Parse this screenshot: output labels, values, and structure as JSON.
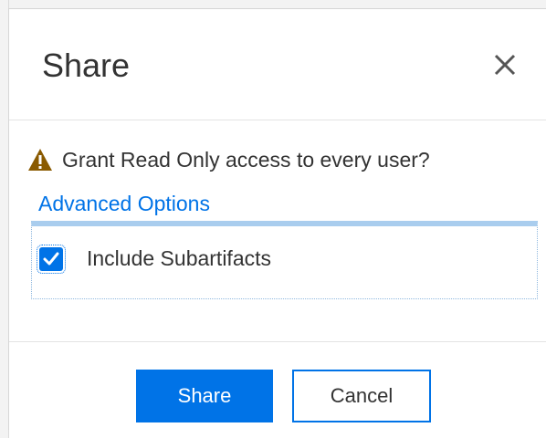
{
  "dialog": {
    "title": "Share",
    "close_icon": "close-icon"
  },
  "warning": {
    "icon": "warning-triangle-icon",
    "color": "#8a5a00",
    "text": "Grant Read Only access to every user?"
  },
  "advanced": {
    "link_label": "Advanced Options",
    "options": [
      {
        "label": "Include Subartifacts",
        "checked": true
      }
    ]
  },
  "footer": {
    "primary_label": "Share",
    "secondary_label": "Cancel"
  },
  "colors": {
    "accent": "#0073e7",
    "panel_border": "#a9cdee"
  }
}
